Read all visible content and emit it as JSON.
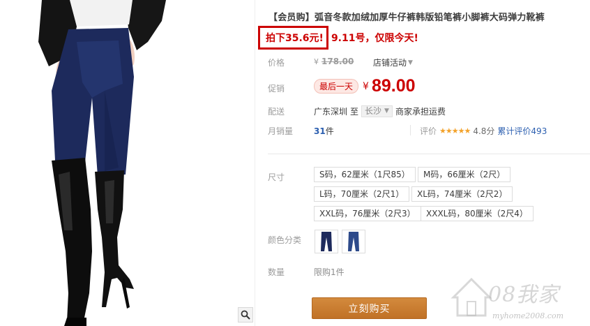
{
  "product": {
    "title": "【会员购】弧音冬款加绒加厚牛仔裤韩版铅笔裤小脚裤大码弹力靴裤",
    "promo_boxed": "拍下35.6元!",
    "promo_rest": "9.11号，仅限今天!"
  },
  "labels": {
    "price": "价格",
    "promotion": "促销",
    "delivery": "配送",
    "monthly_sales": "月销量",
    "size": "尺寸",
    "color": "颜色分类",
    "quantity": "数量"
  },
  "price": {
    "currency": "¥",
    "original": "178.00",
    "shop_activity": "店铺活动",
    "badge": "最后一天",
    "sale": "89.00"
  },
  "delivery": {
    "origin": "广东深圳",
    "to": "至",
    "destination": "长沙",
    "note": "商家承担运费"
  },
  "sales": {
    "count": "31",
    "unit": "件",
    "rating_label": "评价",
    "stars": "★★★★★",
    "score": "4.8分",
    "reviews": "累计评价493"
  },
  "sizes": [
    "S码，62厘米（1尺85）",
    "M码，66厘米（2尺）",
    "L码，70厘米（2尺1）",
    "XL码，74厘米（2尺2）",
    "XXL码，76厘米（2尺3）",
    "XXXL码，80厘米（2尺4）"
  ],
  "colors": [
    "dark-blue-jeans",
    "blue-jeans"
  ],
  "quantity": {
    "limit": "限购1件"
  },
  "buy_button": "立刻购买",
  "watermark": {
    "brand": "08我家",
    "url": "myhome2008.com"
  },
  "icons": {
    "zoom": "magnifier-icon",
    "home": "house-icon"
  },
  "colors_theme": {
    "accent_red": "#cc0000",
    "button": "#c97b2c",
    "link": "#2c5fb0"
  }
}
